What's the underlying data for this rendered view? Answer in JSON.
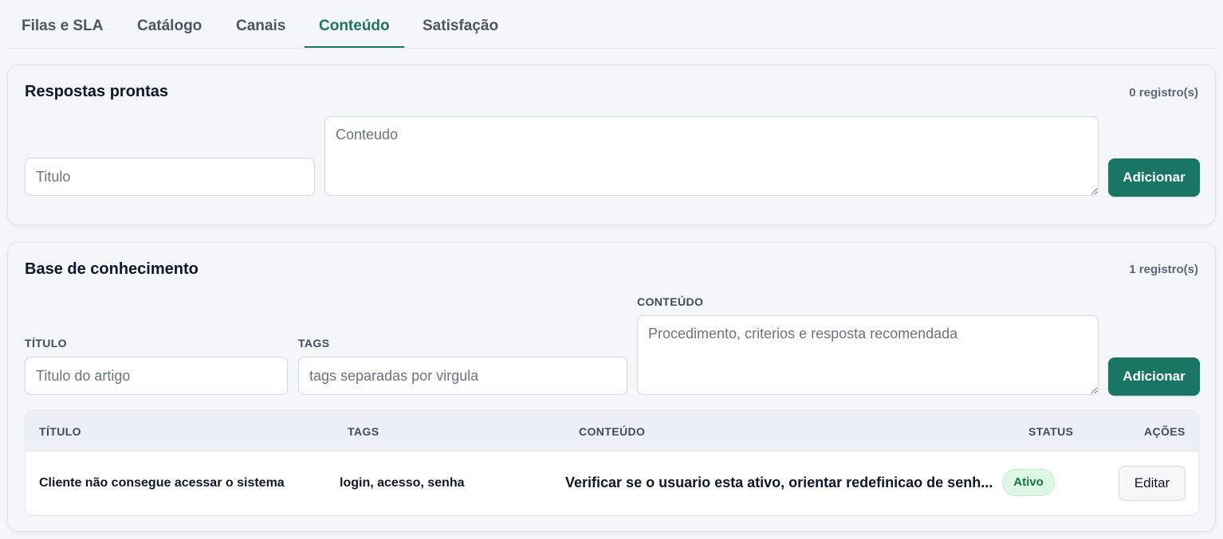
{
  "tabs": [
    "Filas e SLA",
    "Catálogo",
    "Canais",
    "Conteúdo",
    "Satisfação"
  ],
  "active_tab": "Conteúdo",
  "respostas": {
    "title": "Respostas prontas",
    "count": "0 registro(s)",
    "titulo_placeholder": "Titulo",
    "conteudo_placeholder": "Conteudo",
    "add_label": "Adicionar"
  },
  "base": {
    "title": "Base de conhecimento",
    "count": "1 registro(s)",
    "label_titulo": "TÍTULO",
    "label_tags": "TAGS",
    "label_conteudo": "CONTEÚDO",
    "titulo_placeholder": "Titulo do artigo",
    "tags_placeholder": "tags separadas por virgula",
    "conteudo_placeholder": "Procedimento, criterios e resposta recomendada",
    "add_label": "Adicionar",
    "table": {
      "headers": [
        "TÍTULO",
        "TAGS",
        "CONTEÚDO",
        "STATUS",
        "AÇÕES"
      ],
      "rows": [
        {
          "titulo": "Cliente não consegue acessar o sistema",
          "tags": "login, acesso, senha",
          "conteudo": "Verificar se o usuario esta ativo, orientar redefinicao de senh...",
          "status": "Ativo",
          "acao": "Editar"
        }
      ]
    }
  },
  "colors": {
    "accent": "#1a7565",
    "status_active_bg": "#dcf7e4",
    "status_active_text": "#16753f"
  }
}
